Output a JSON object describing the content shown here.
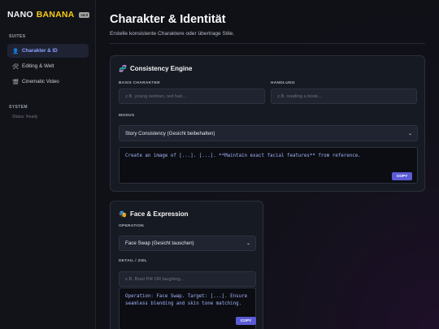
{
  "logo": {
    "part1": "NANO",
    "part2": "BANANA",
    "badge": "v4.0"
  },
  "sidebar": {
    "section_suites": "SUITES",
    "items": [
      {
        "icon": "👤",
        "label": "Charakter & ID",
        "active": true
      },
      {
        "icon": "🛠",
        "label": "Editing & Welt",
        "active": false
      },
      {
        "icon": "🎬",
        "label": "Cinematic Video",
        "active": false
      }
    ],
    "section_system": "SYSTEM",
    "status": "Status: Ready"
  },
  "header": {
    "title": "Charakter & Identität",
    "subtitle": "Erstelle konsistente Charaktere oder übertrage Stile."
  },
  "consistency": {
    "icon": "🧬",
    "title": "Consistency Engine",
    "basis_label": "BASIS CHARAKTER",
    "basis_placeholder": "z.B. young woman, red hair...",
    "handlung_label": "HANDLUNG",
    "handlung_placeholder": "z.B. reading a book...",
    "modus_label": "MODUS",
    "modus_value": "Story Consistency (Gesicht beibehalten)",
    "output": "Create an image of [...]. [...]. **Maintain exact facial features** from reference.",
    "copy_label": "COPY"
  },
  "face": {
    "icon": "🎭",
    "title": "Face & Expression",
    "operation_label": "OPERATION",
    "operation_value": "Face Swap (Gesicht tauschen)",
    "detail_label": "DETAIL / ZIEL",
    "detail_placeholder": "z.B. Brad Pitt OR laughing...",
    "output": "Operation: Face Swap. Target: [...]. Ensure seamless blending and skin tone matching.",
    "copy_label": "COPY"
  }
}
